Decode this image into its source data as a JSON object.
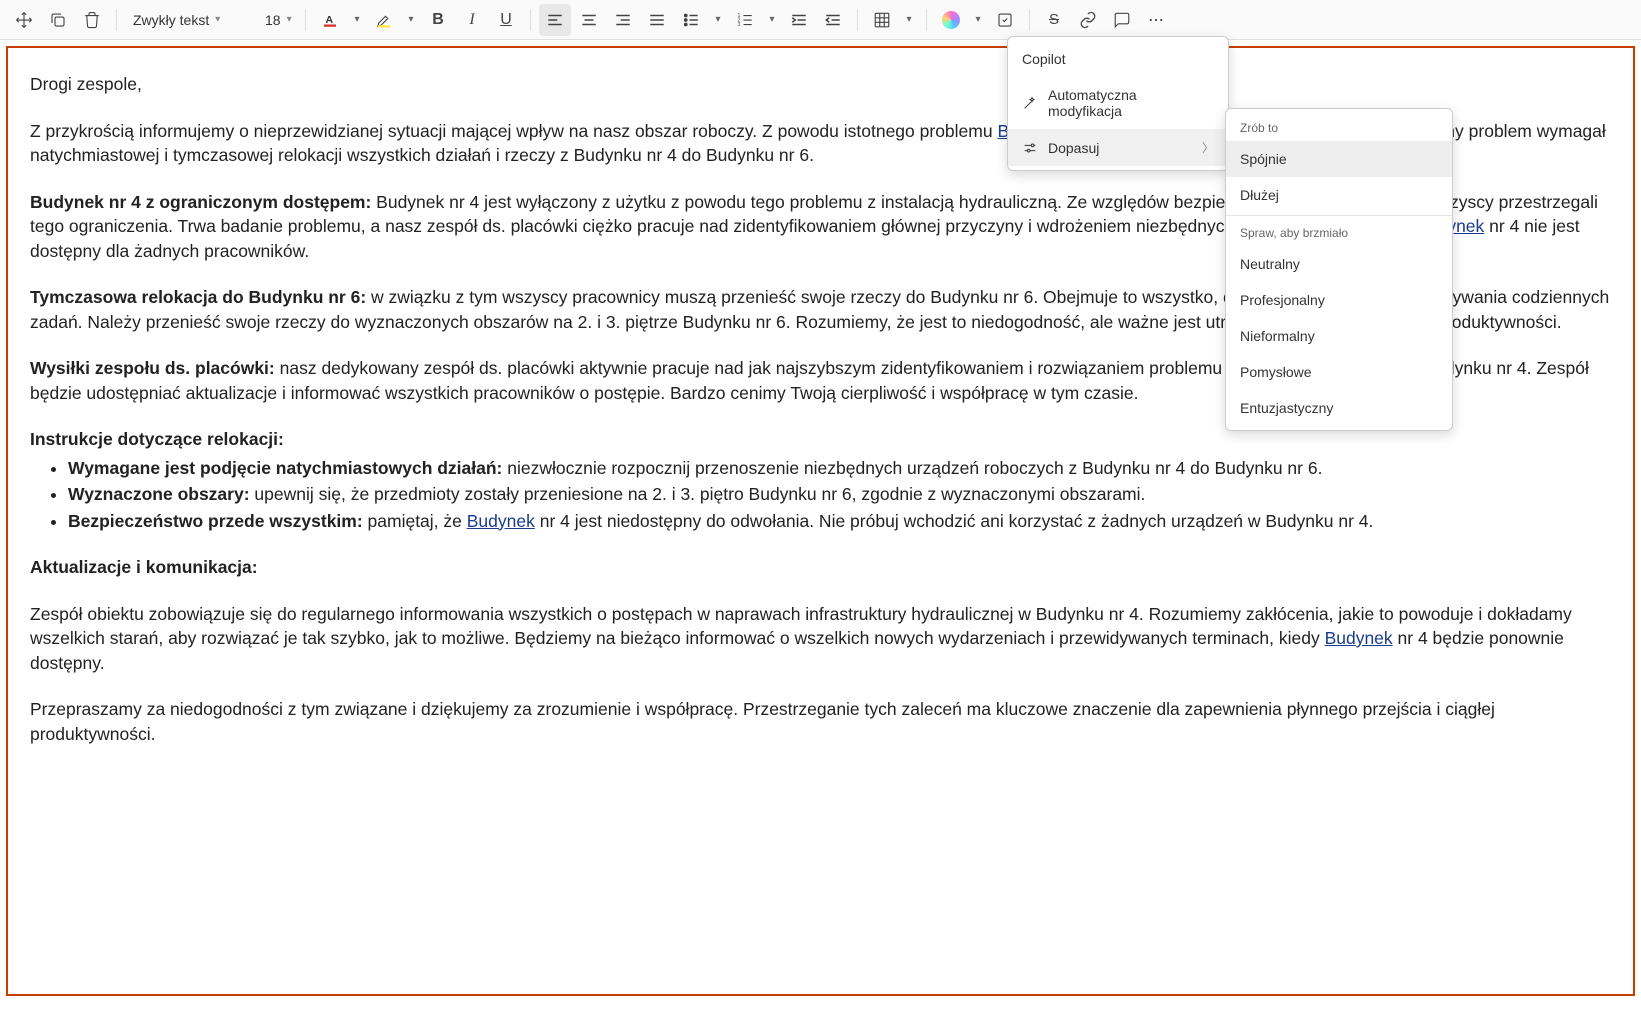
{
  "toolbar": {
    "style_label": "Zwykły tekst",
    "font_size": "18"
  },
  "copilot_menu": {
    "copilot": "Copilot",
    "auto_mod": "Automatyczna modyfikacja",
    "adjust": "Dopasuj"
  },
  "submenu": {
    "hdr1": "Zrób to",
    "items1": [
      "Spójnie",
      "Dłużej"
    ],
    "hdr2": "Spraw, aby brzmiało",
    "items2": [
      "Neutralny",
      "Profesjonalny",
      "Nieformalny",
      "Pomysłowe",
      "Entuzjastyczny"
    ]
  },
  "doc": {
    "greeting": "Drogi zespole,",
    "p1_a": "Z przykrością informujemy o nieprzewidzianej sytuacji mającej wpływ na nasz obszar roboczy. Z powodu istotnego problemu ",
    "p1_link": "Budynek",
    "p1_b": " nr 4 jest obecnie niedostępny. Ten nieprzewidziany problem wymagał natychmiastowej i tymczasowej relokacji wszystkich działań i rzeczy z Budynku nr 4 do Budynku nr 6.",
    "h4": "Budynek nr 4 z ograniczonym dostępem:",
    "p4_a": " Budynek nr 4 jest wyłączony z użytku z powodu tego problemu z instalacją hydrauliczną. Ze względów bezpieczeństwa ważne jest, aby wszyscy przestrzegali tego ograniczenia. Trwa badanie problemu, a nasz zespół ds. placówki ciężko pracuje nad zidentyfikowaniem głównej przyczyny i wdrożeniem niezbędnych napraw. Do odwołania ",
    "p4_link": "Budynek",
    "p4_b": " nr 4 nie jest dostępny dla żadnych pracowników.",
    "h5": "Tymczasowa relokacja do Budynku nr 6:",
    "p5": " w związku z tym wszyscy pracownicy muszą przenieść swoje rzeczy do Budynku nr 6. Obejmuje to wszystko, czego potrzebujesz do wykonywania codziennych zadań. Należy przenieść swoje rzeczy do wyznaczonych obszarów na 2. i 3. piętrze Budynku nr 6. Rozumiemy, że jest to niedogodność, ale ważne jest utrzymanie przepływu pracy i produktywności.",
    "h6": "Wysiłki zespołu ds. placówki:",
    "p6": " nasz dedykowany zespół ds. placówki aktywnie pracuje nad jak najszybszym zidentyfikowaniem i rozwiązaniem problemu instalacji hydraulicznej w Budynku nr 4. Zespół będzie udostępniać aktualizacje i informować wszystkich pracowników o postępie. Bardzo cenimy Twoją cierpliwość i współpracę w tym czasie.",
    "h7": "Instrukcje dotyczące relokacji:",
    "li1_h": "Wymagane jest podjęcie natychmiastowych działań:",
    "li1_t": " niezwłocznie rozpocznij przenoszenie niezbędnych urządzeń roboczych z Budynku nr 4 do Budynku nr 6.",
    "li2_h": "Wyznaczone obszary:",
    "li2_t": " upewnij się, że przedmioty zostały przeniesione na 2. i 3. piętro Budynku nr 6, zgodnie z wyznaczonymi obszarami.",
    "li3_h": "Bezpieczeństwo przede wszystkim:",
    "li3_a": " pamiętaj, że ",
    "li3_link": "Budynek",
    "li3_b": " nr 4 jest niedostępny do odwołania. Nie próbuj wchodzić ani korzystać z żadnych urządzeń w Budynku nr 4.",
    "h8": "Aktualizacje i komunikacja:",
    "p8_a": "Zespół obiektu zobowiązuje się do regularnego informowania wszystkich o postępach w naprawach infrastruktury hydraulicznej w Budynku nr 4. Rozumiemy zakłócenia, jakie to powoduje i dokładamy wszelkich starań, aby rozwiązać je tak szybko, jak to możliwe. Będziemy na bieżąco informować o wszelkich nowych wydarzeniach i przewidywanych terminach, kiedy ",
    "p8_link": "Budynek",
    "p8_b": " nr 4 będzie ponownie dostępny.",
    "p9": "Przepraszamy za niedogodności z tym związane i dziękujemy za zrozumienie i współpracę. Przestrzeganie tych zaleceń ma kluczowe znaczenie dla zapewnienia płynnego przejścia i ciągłej produktywności."
  }
}
